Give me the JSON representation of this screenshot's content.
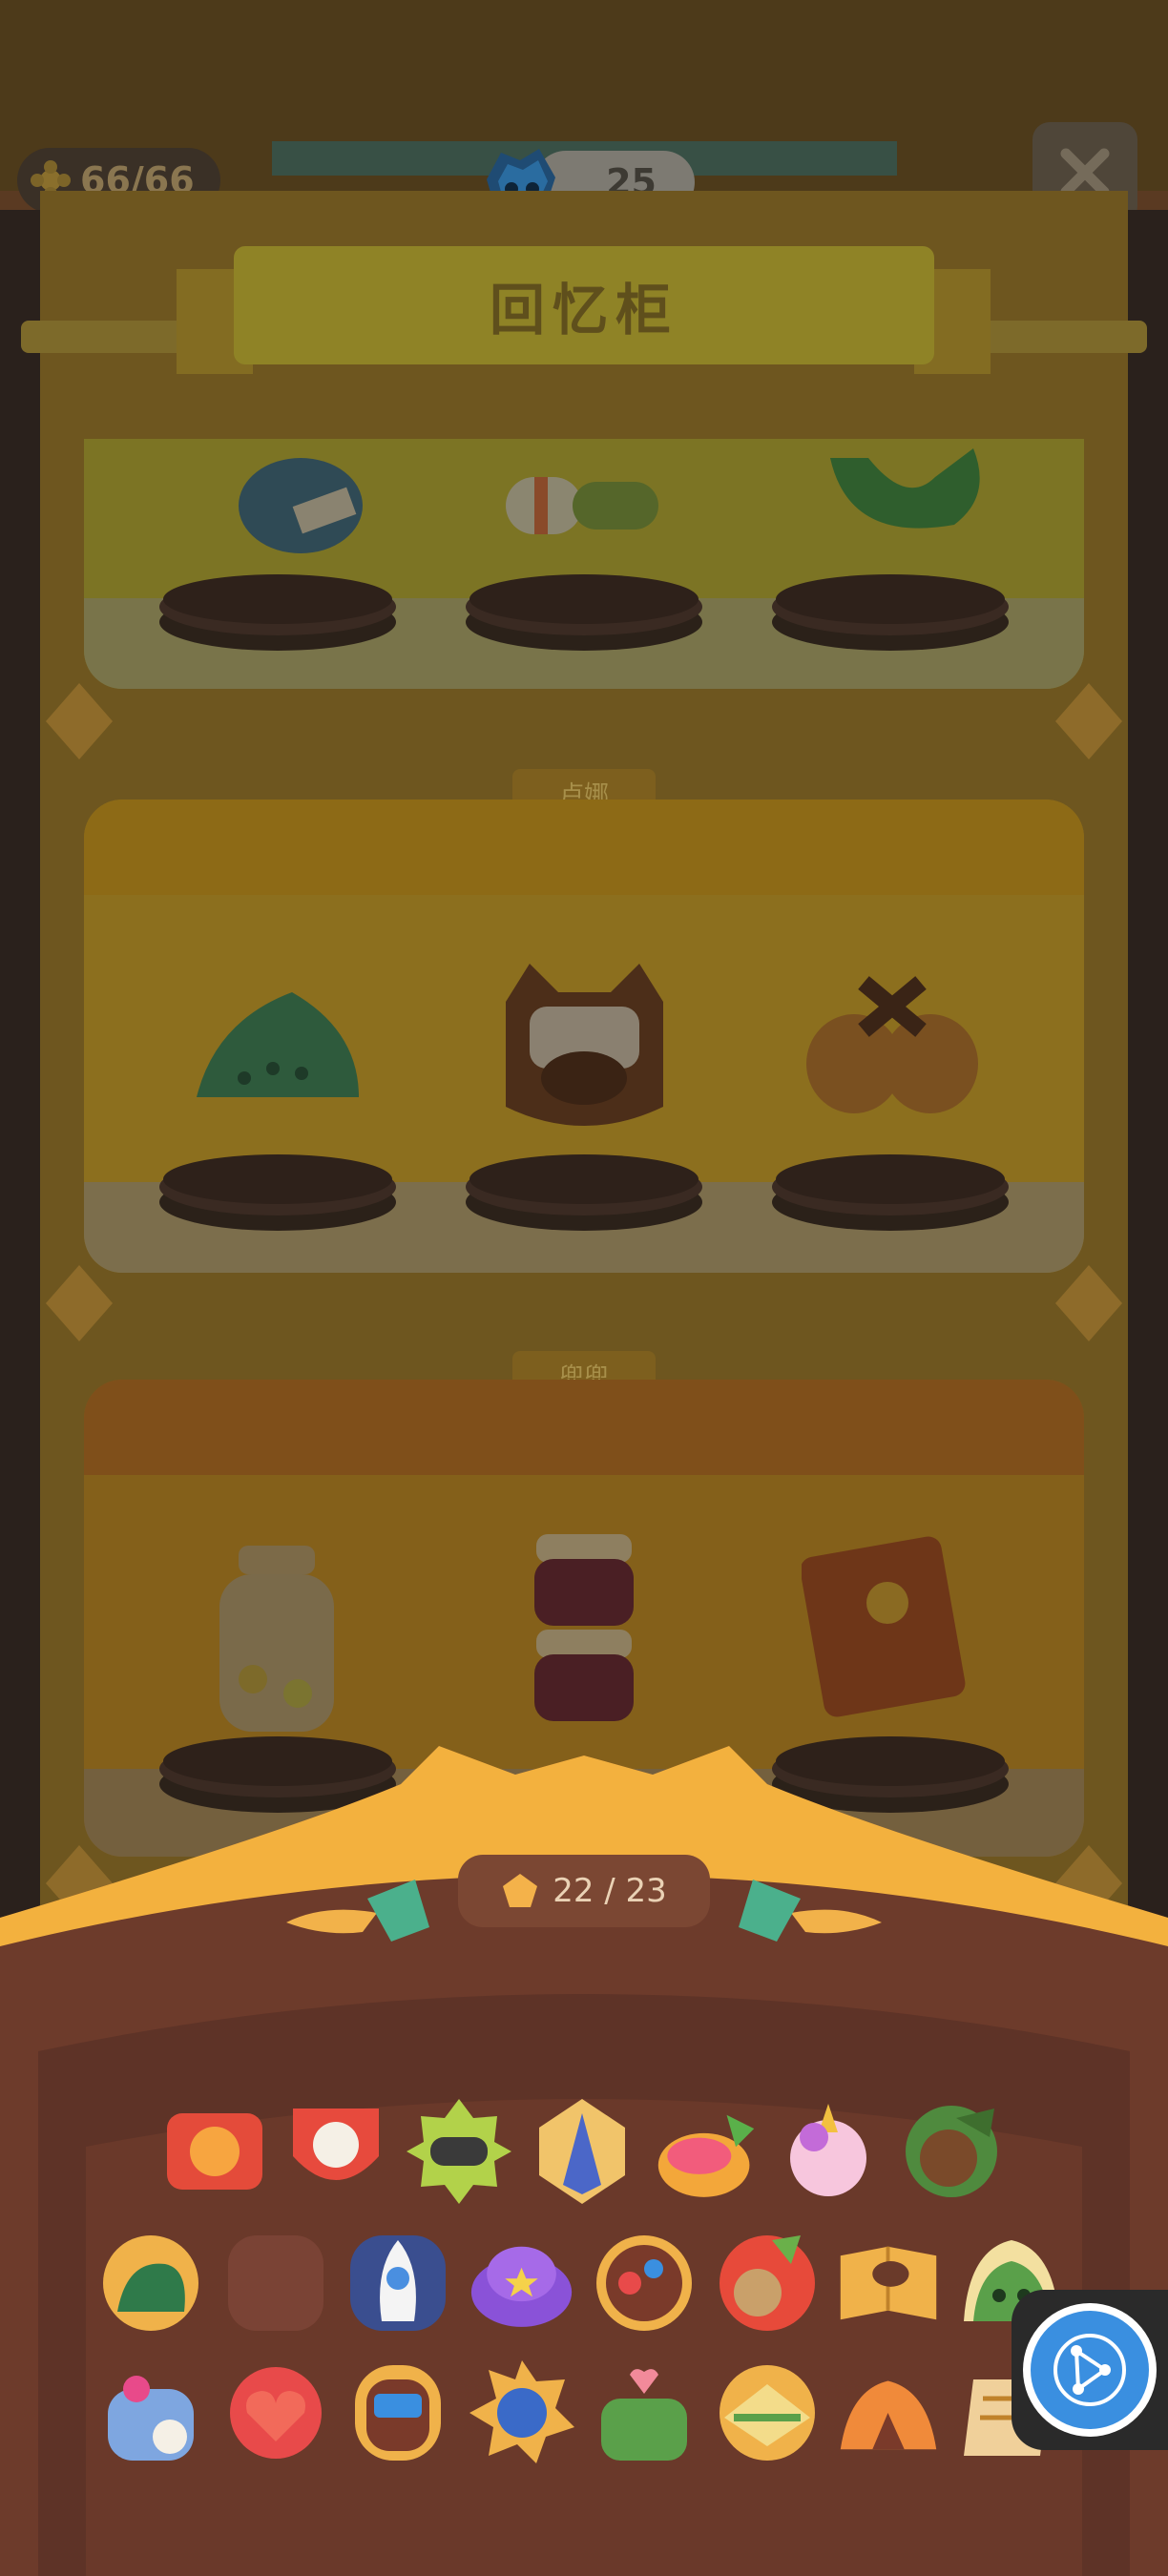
{
  "header": {
    "currency_count": "66/66",
    "gem_count": "25",
    "title": "回忆柜"
  },
  "shelves": [
    {
      "label": ""
    },
    {
      "label": "卢娜"
    },
    {
      "label": "兜兜"
    }
  ],
  "collection": {
    "progress_text": "22 / 23"
  },
  "icons": {
    "close": "close-icon",
    "currency": "flower-coin-icon",
    "gem": "blue-gem-creature-icon",
    "fab": "share-network-icon"
  },
  "colors": {
    "panel_brown": "#6d3b2b",
    "panel_inner": "#5e3327",
    "accent_gold": "#f3b13e",
    "fab_blue": "#3a8fe0"
  }
}
